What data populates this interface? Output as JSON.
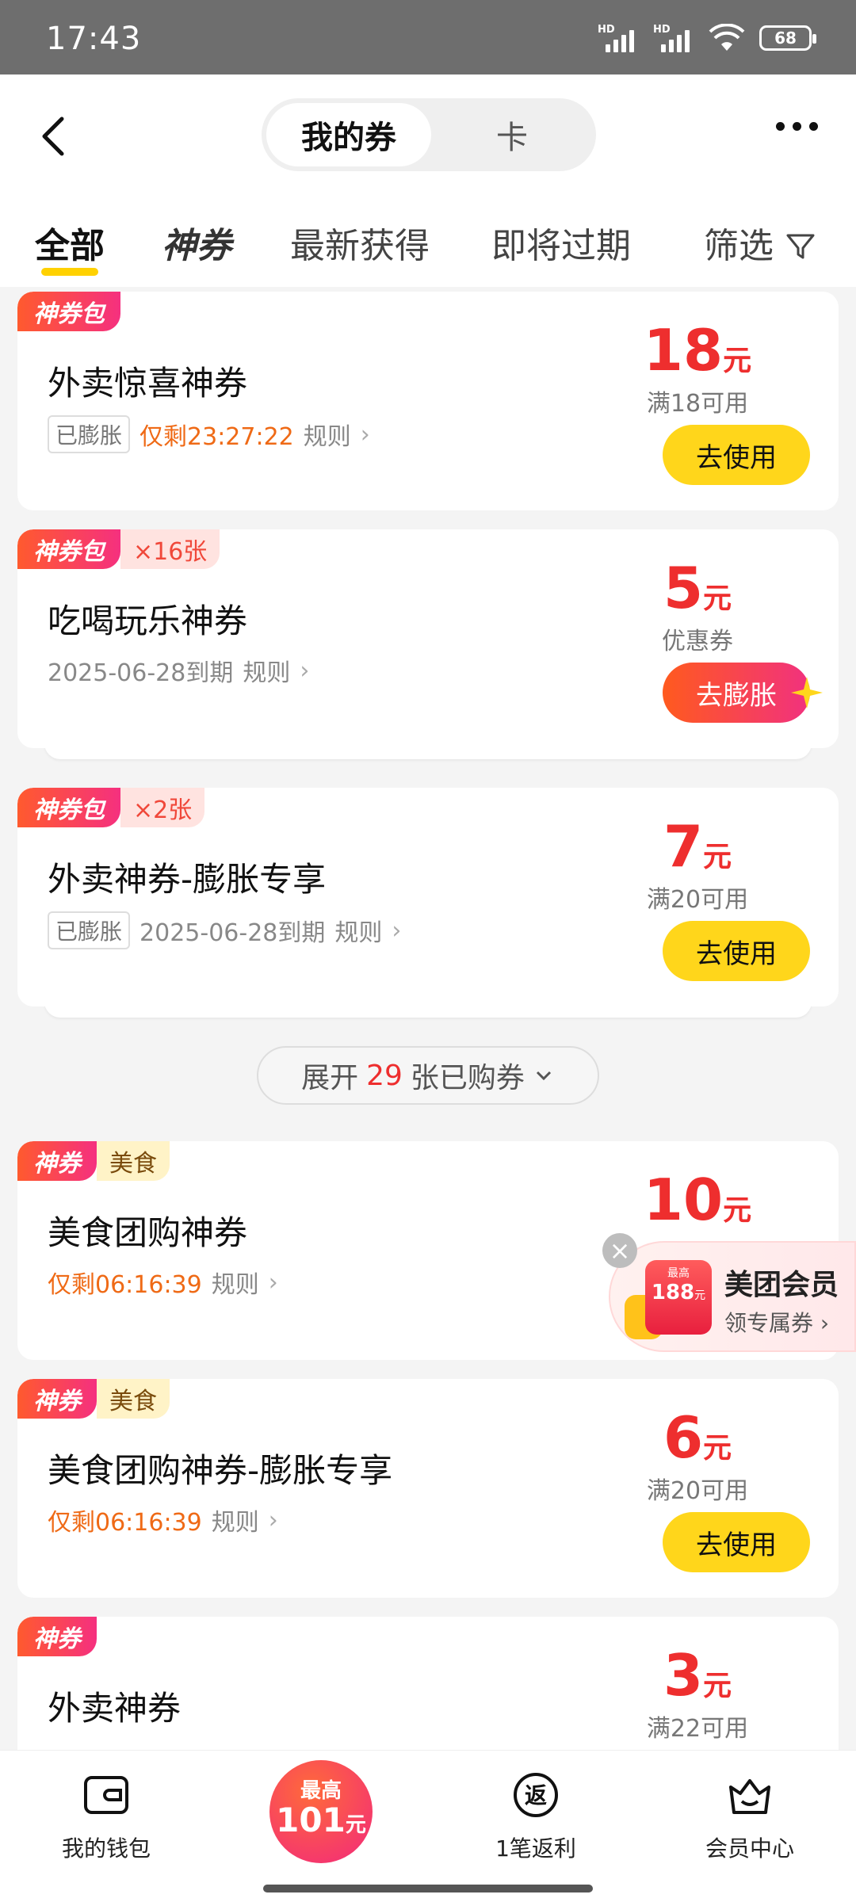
{
  "status": {
    "time": "17:43",
    "signal_label": "HD",
    "battery": "68"
  },
  "header": {
    "seg_active": "我的券",
    "seg_inactive": "卡"
  },
  "tabs": [
    "全部",
    "神券",
    "最新获得",
    "即将过期",
    "筛选"
  ],
  "cards": [
    {
      "tag": "神券包",
      "count": "",
      "title": "外卖惊喜神券",
      "pill": "已膨胀",
      "timer": "仅剩23:27:22",
      "rule": "规则",
      "amount": "18",
      "unit": "元",
      "cond": "满18可用",
      "button": "去使用"
    },
    {
      "tag": "神券包",
      "count": "×16张",
      "title": "吃喝玩乐神券",
      "date": "2025-06-28到期",
      "rule": "规则",
      "amount": "5",
      "unit": "元",
      "cond": "优惠券",
      "button": "去膨胀"
    },
    {
      "tag": "神券包",
      "count": "×2张",
      "title": "外卖神券-膨胀专享",
      "pill": "已膨胀",
      "date": "2025-06-28到期",
      "rule": "规则",
      "amount": "7",
      "unit": "元",
      "cond": "满20可用",
      "button": "去使用"
    },
    {
      "tag": "神券",
      "food": "美食",
      "title": "美食团购神券",
      "timer": "仅剩06:16:39",
      "rule": "规则",
      "amount": "10",
      "unit": "元"
    },
    {
      "tag": "神券",
      "food": "美食",
      "title": "美食团购神券-膨胀专享",
      "timer": "仅剩06:16:39",
      "rule": "规则",
      "amount": "6",
      "unit": "元",
      "cond": "满20可用",
      "button": "去使用"
    },
    {
      "tag": "神券",
      "title": "外卖神券",
      "amount": "3",
      "unit": "元",
      "cond": "满22可用"
    }
  ],
  "expand": {
    "prefix": "展开",
    "count": "29",
    "suffix": "张已购券"
  },
  "member": {
    "badge_small": "最高",
    "badge_big": "188",
    "badge_unit": "元",
    "title": "美团会员",
    "sub": "领专属券"
  },
  "bottom_nav": {
    "wallet": "我的钱包",
    "promo_top": "最高",
    "promo_num": "101",
    "promo_unit": "元",
    "rebate_icon": "返",
    "rebate": "1笔返利",
    "vip": "会员中心"
  },
  "colors": {
    "accent_yellow": "#ffd61b",
    "price_red": "#ee2e2e",
    "timer_orange": "#ef6a16"
  }
}
